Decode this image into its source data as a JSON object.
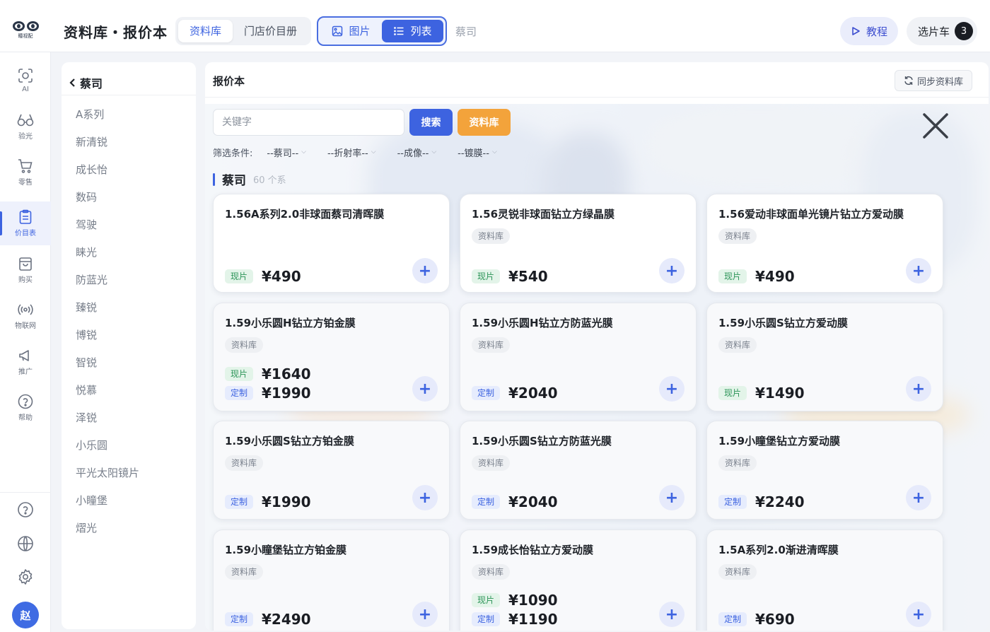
{
  "header": {
    "logo_text": "瞳视配",
    "app_title": "资料库・报价本",
    "nav_tabs": [
      {
        "label": "资料库",
        "active": true
      },
      {
        "label": "门店价目册",
        "active": false
      }
    ],
    "view_toggle": [
      {
        "label": "图片",
        "icon": "image-icon",
        "active": false
      },
      {
        "label": "列表",
        "icon": "list-icon",
        "active": true
      }
    ],
    "current_brand": "蔡司",
    "tutorial_label": "教程",
    "cart_label": "选片车",
    "cart_count": "3"
  },
  "rail": {
    "items": [
      {
        "label": "AI",
        "icon": "ai-scan-icon",
        "active": false
      },
      {
        "label": "验光",
        "icon": "glasses-icon",
        "active": false
      },
      {
        "label": "零售",
        "icon": "cart-icon",
        "active": false
      },
      {
        "label": "价目表",
        "icon": "price-list-icon",
        "active": true
      },
      {
        "label": "购买",
        "icon": "shopping-bag-icon",
        "active": false
      },
      {
        "label": "物联网",
        "icon": "broadcast-icon",
        "active": false
      },
      {
        "label": "推广",
        "icon": "megaphone-icon",
        "active": false
      },
      {
        "label": "帮助",
        "icon": "help-icon",
        "active": false
      }
    ],
    "bottom": [
      {
        "icon": "question-icon"
      },
      {
        "icon": "globe-icon"
      },
      {
        "icon": "gear-icon"
      }
    ],
    "avatar_text": "赵"
  },
  "series_panel": {
    "back_label": "蔡司",
    "items": [
      "A系列",
      "新清锐",
      "成长怡",
      "数码",
      "驾驶",
      "睐光",
      "防蓝光",
      "臻锐",
      "博锐",
      "智锐",
      "悦慕",
      "泽锐",
      "小乐圆",
      "平光太阳镜片",
      "小瞳堡",
      "熠光"
    ]
  },
  "main": {
    "title": "报价本",
    "sync_label": "同步资料库",
    "search": {
      "placeholder": "关键字",
      "value": ""
    },
    "search_label": "搜索",
    "library_label": "资料库",
    "filter_label": "筛选条件:",
    "filters": [
      "--蔡司--",
      "--折射率--",
      "--成像--",
      "--镀膜--"
    ],
    "group": {
      "name": "蔡司",
      "count": "60 个系"
    },
    "colors": {
      "accent": "#3d63e0",
      "orange": "#f3a33b",
      "stock": "#2b9457"
    },
    "products": [
      {
        "title": "1.56A系列2.0非球面蔡司清晖膜",
        "tag": "",
        "prices": [
          {
            "type": "现片",
            "kind": "stock",
            "value": "¥490"
          }
        ]
      },
      {
        "title": "1.56灵锐非球面钻立方绿晶膜",
        "tag": "资料库",
        "prices": [
          {
            "type": "现片",
            "kind": "stock",
            "value": "¥540"
          }
        ]
      },
      {
        "title": "1.56爱动非球面单光镜片钻立方爱动膜",
        "tag": "资料库",
        "prices": [
          {
            "type": "现片",
            "kind": "stock",
            "value": "¥490"
          }
        ]
      },
      {
        "title": "1.59小乐圆H钻立方铂金膜",
        "tag": "资料库",
        "prices": [
          {
            "type": "现片",
            "kind": "stock",
            "value": "¥1640"
          },
          {
            "type": "定制",
            "kind": "custom",
            "value": "¥1990"
          }
        ]
      },
      {
        "title": "1.59小乐圆H钻立方防蓝光膜",
        "tag": "资料库",
        "prices": [
          {
            "type": "定制",
            "kind": "custom",
            "value": "¥2040"
          }
        ]
      },
      {
        "title": "1.59小乐圆S钻立方爱动膜",
        "tag": "资料库",
        "prices": [
          {
            "type": "现片",
            "kind": "stock",
            "value": "¥1490"
          }
        ]
      },
      {
        "title": "1.59小乐圆S钻立方铂金膜",
        "tag": "资料库",
        "prices": [
          {
            "type": "定制",
            "kind": "custom",
            "value": "¥1990"
          }
        ]
      },
      {
        "title": "1.59小乐圆S钻立方防蓝光膜",
        "tag": "资料库",
        "prices": [
          {
            "type": "定制",
            "kind": "custom",
            "value": "¥2040"
          }
        ]
      },
      {
        "title": "1.59小瞳堡钻立方爱动膜",
        "tag": "资料库",
        "prices": [
          {
            "type": "定制",
            "kind": "custom",
            "value": "¥2240"
          }
        ]
      },
      {
        "title": "1.59小瞳堡钻立方铂金膜",
        "tag": "资料库",
        "prices": [
          {
            "type": "定制",
            "kind": "custom",
            "value": "¥2490"
          }
        ]
      },
      {
        "title": "1.59成长怡钻立方爱动膜",
        "tag": "资料库",
        "prices": [
          {
            "type": "现片",
            "kind": "stock",
            "value": "¥1090"
          },
          {
            "type": "定制",
            "kind": "custom",
            "value": "¥1190"
          }
        ]
      },
      {
        "title": "1.5A系列2.0渐进清晖膜",
        "tag": "资料库",
        "prices": [
          {
            "type": "定制",
            "kind": "custom",
            "value": "¥690"
          }
        ]
      }
    ]
  }
}
